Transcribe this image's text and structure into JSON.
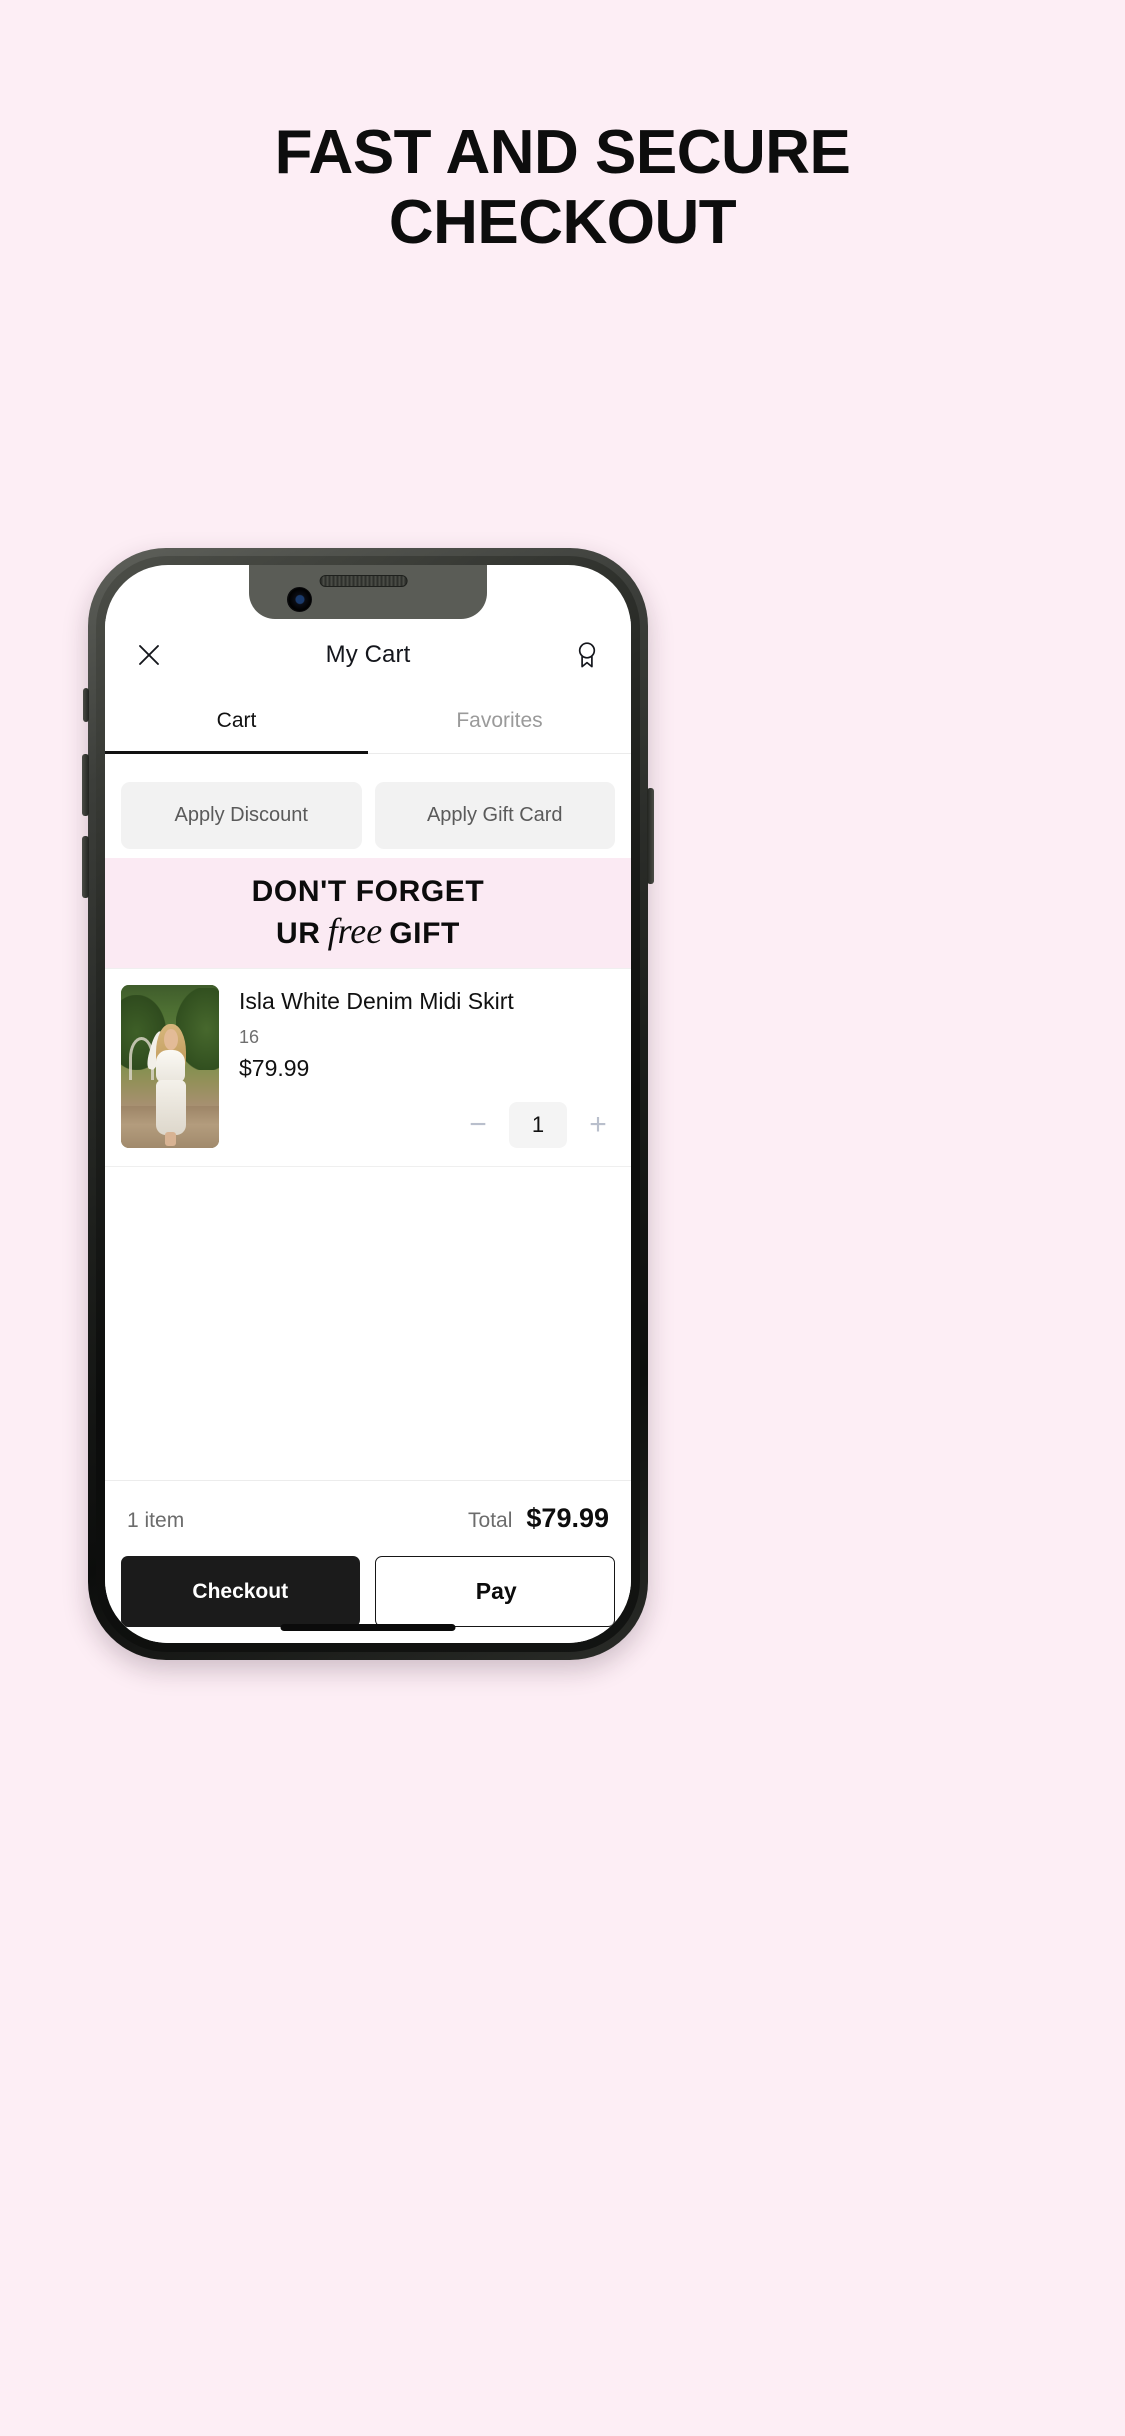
{
  "page": {
    "background_color": "#fdeef5",
    "headline_line1": "FAST AND SECURE",
    "headline_line2": "CHECKOUT"
  },
  "app": {
    "header": {
      "close_icon": "close-icon",
      "title": "My Cart",
      "rewards_icon": "reward-badge-icon"
    },
    "tabs": [
      {
        "label": "Cart",
        "active": true
      },
      {
        "label": "Favorites",
        "active": false
      }
    ],
    "promo_buttons": [
      {
        "label": "Apply Discount"
      },
      {
        "label": "Apply Gift Card"
      }
    ],
    "gift_banner": {
      "line1": "DON'T FORGET",
      "line2_pre": "UR",
      "line2_em": "free",
      "line2_post": "GIFT",
      "background_color": "#fbeaf3"
    },
    "cart_items": [
      {
        "title": "Isla White Denim Midi Skirt",
        "size": "16",
        "price": "$79.99",
        "quantity": "1",
        "decrease_label": "−",
        "increase_label": "+",
        "thumbnail_alt": "product-photo"
      }
    ],
    "footer": {
      "item_count": "1 item",
      "total_label": "Total",
      "total_value": "$79.99",
      "checkout_label": "Checkout",
      "apple_pay_glyph": "",
      "apple_pay_label": "Pay"
    }
  }
}
